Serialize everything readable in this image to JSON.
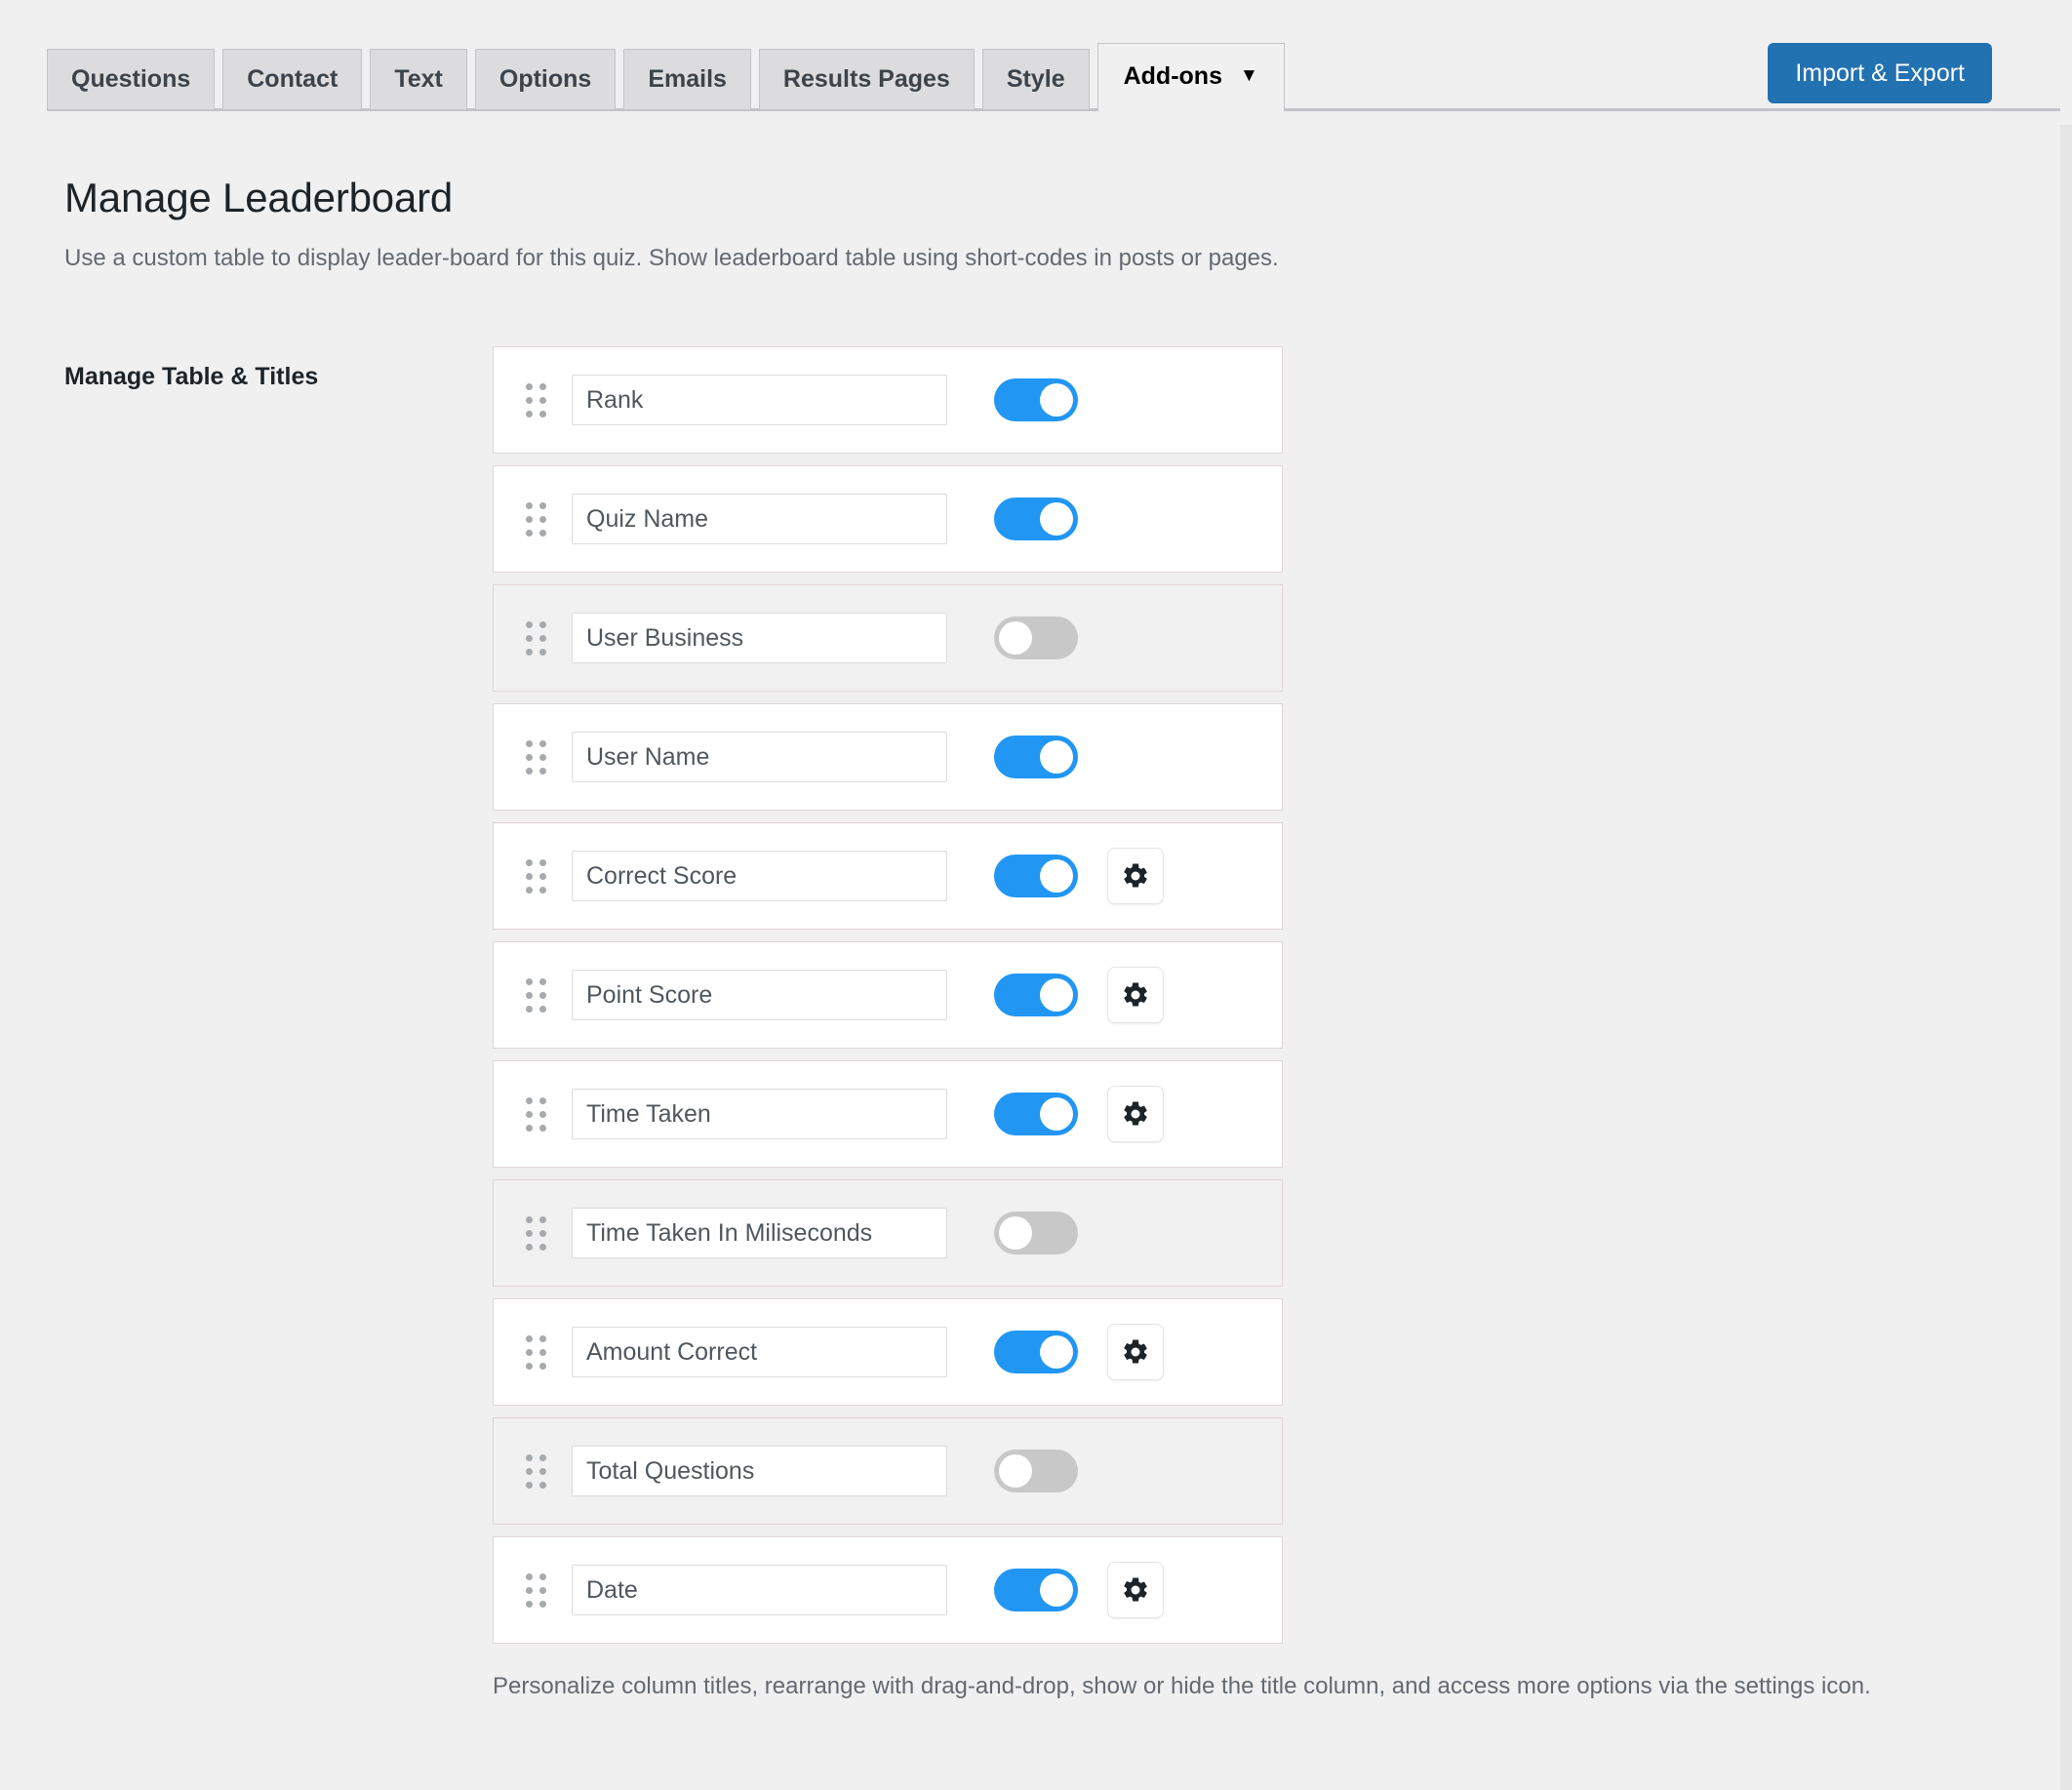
{
  "tabs": [
    {
      "label": "Questions",
      "active": false,
      "caret": false
    },
    {
      "label": "Contact",
      "active": false,
      "caret": false
    },
    {
      "label": "Text",
      "active": false,
      "caret": false
    },
    {
      "label": "Options",
      "active": false,
      "caret": false
    },
    {
      "label": "Emails",
      "active": false,
      "caret": false
    },
    {
      "label": "Results Pages",
      "active": false,
      "caret": false
    },
    {
      "label": "Style",
      "active": false,
      "caret": false
    },
    {
      "label": "Add-ons",
      "active": true,
      "caret": true,
      "caret_glyph": "▼"
    }
  ],
  "toolbar": {
    "import_export_label": "Import & Export"
  },
  "header": {
    "title": "Manage Leaderboard",
    "description": "Use a custom table to display leader-board for this quiz. Show leaderboard table using short-codes in posts or pages."
  },
  "section": {
    "label": "Manage Table & Titles"
  },
  "rows": [
    {
      "value": "Rank",
      "enabled": true,
      "has_settings": false
    },
    {
      "value": "Quiz Name",
      "enabled": true,
      "has_settings": false
    },
    {
      "value": "User Business",
      "enabled": false,
      "has_settings": false
    },
    {
      "value": "User Name",
      "enabled": true,
      "has_settings": false
    },
    {
      "value": "Correct Score",
      "enabled": true,
      "has_settings": true
    },
    {
      "value": "Point Score",
      "enabled": true,
      "has_settings": true
    },
    {
      "value": "Time Taken",
      "enabled": true,
      "has_settings": true
    },
    {
      "value": "Time Taken In Miliseconds",
      "enabled": false,
      "has_settings": false
    },
    {
      "value": "Amount Correct",
      "enabled": true,
      "has_settings": true
    },
    {
      "value": "Total Questions",
      "enabled": false,
      "has_settings": false
    },
    {
      "value": "Date",
      "enabled": true,
      "has_settings": true
    }
  ],
  "footer": {
    "help_text": "Personalize column titles, rearrange with drag-and-drop, show or hide the title column, and access more options via the settings icon."
  },
  "icons": {
    "drag_handle": "drag-handle-icon",
    "settings": "gear-icon",
    "dropdown": "chevron-down-icon"
  },
  "colors": {
    "accent_button": "#2271b1",
    "toggle_on": "#2196f3",
    "toggle_off": "#c8c8c8",
    "page_bg": "#f0f0f1",
    "row_disabled_bg": "#f2f1f1"
  }
}
